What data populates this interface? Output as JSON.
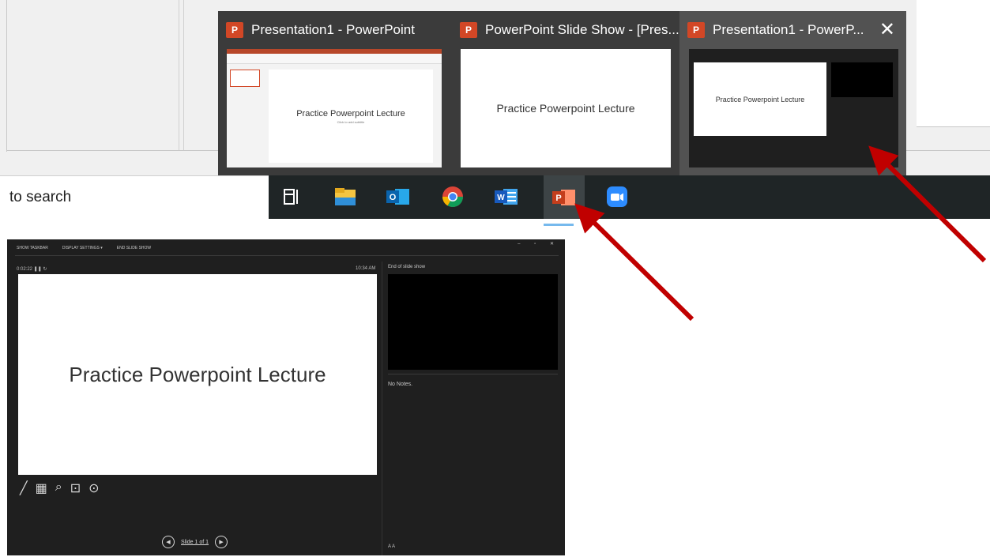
{
  "search": {
    "text": "to search"
  },
  "flyout": {
    "items": [
      {
        "title": "Presentation1 - PowerPoint",
        "badge": "P"
      },
      {
        "title": "PowerPoint Slide Show - [Pres...",
        "badge": "P"
      },
      {
        "title": "Presentation1 - PowerP...",
        "badge": "P"
      }
    ],
    "close_glyph": "✕",
    "preview_editor_text": "Practice Powerpoint Lecture",
    "preview_editor_sub": "Click to add subtitle",
    "preview_slideshow_text": "Practice Powerpoint Lecture",
    "preview_presenter_text": "Practice Powerpoint Lecture"
  },
  "taskbar": {
    "icons": [
      "task-view-icon",
      "file-explorer-icon",
      "outlook-icon",
      "chrome-icon",
      "word-icon",
      "powerpoint-icon",
      "zoom-icon"
    ],
    "word_letter": "W",
    "outlook_letter": "O",
    "ppt_letter": "P"
  },
  "presenter": {
    "toolbar": {
      "show_taskbar": "SHOW TASKBAR",
      "display_settings": "DISPLAY SETTINGS ▾",
      "end_show": "END SLIDE SHOW"
    },
    "window_controls": "– ▫ ✕",
    "timer": "0:02:22  ❚❚  ↻",
    "clock": "10:34 AM",
    "slide_title": "Practice Powerpoint Lecture",
    "next_label": "End of slide show",
    "notes": "No Notes.",
    "nav_text": "Slide 1 of 1",
    "font_buttons": "A  A"
  },
  "colors": {
    "arrow": "#c00000",
    "ppt": "#d24726"
  }
}
